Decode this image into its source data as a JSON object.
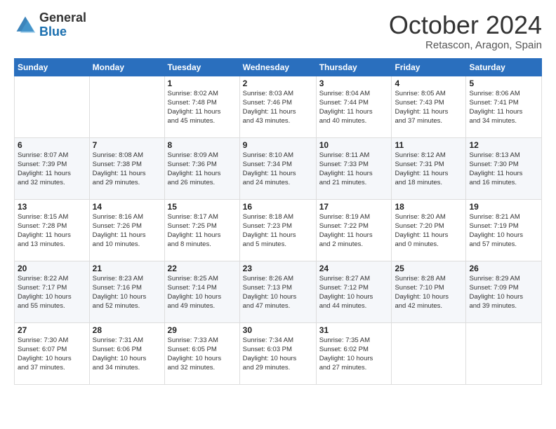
{
  "header": {
    "logo_general": "General",
    "logo_blue": "Blue",
    "month_title": "October 2024",
    "location": "Retascon, Aragon, Spain"
  },
  "days_of_week": [
    "Sunday",
    "Monday",
    "Tuesday",
    "Wednesday",
    "Thursday",
    "Friday",
    "Saturday"
  ],
  "weeks": [
    [
      {
        "day": "",
        "info": ""
      },
      {
        "day": "",
        "info": ""
      },
      {
        "day": "1",
        "info": "Sunrise: 8:02 AM\nSunset: 7:48 PM\nDaylight: 11 hours\nand 45 minutes."
      },
      {
        "day": "2",
        "info": "Sunrise: 8:03 AM\nSunset: 7:46 PM\nDaylight: 11 hours\nand 43 minutes."
      },
      {
        "day": "3",
        "info": "Sunrise: 8:04 AM\nSunset: 7:44 PM\nDaylight: 11 hours\nand 40 minutes."
      },
      {
        "day": "4",
        "info": "Sunrise: 8:05 AM\nSunset: 7:43 PM\nDaylight: 11 hours\nand 37 minutes."
      },
      {
        "day": "5",
        "info": "Sunrise: 8:06 AM\nSunset: 7:41 PM\nDaylight: 11 hours\nand 34 minutes."
      }
    ],
    [
      {
        "day": "6",
        "info": "Sunrise: 8:07 AM\nSunset: 7:39 PM\nDaylight: 11 hours\nand 32 minutes."
      },
      {
        "day": "7",
        "info": "Sunrise: 8:08 AM\nSunset: 7:38 PM\nDaylight: 11 hours\nand 29 minutes."
      },
      {
        "day": "8",
        "info": "Sunrise: 8:09 AM\nSunset: 7:36 PM\nDaylight: 11 hours\nand 26 minutes."
      },
      {
        "day": "9",
        "info": "Sunrise: 8:10 AM\nSunset: 7:34 PM\nDaylight: 11 hours\nand 24 minutes."
      },
      {
        "day": "10",
        "info": "Sunrise: 8:11 AM\nSunset: 7:33 PM\nDaylight: 11 hours\nand 21 minutes."
      },
      {
        "day": "11",
        "info": "Sunrise: 8:12 AM\nSunset: 7:31 PM\nDaylight: 11 hours\nand 18 minutes."
      },
      {
        "day": "12",
        "info": "Sunrise: 8:13 AM\nSunset: 7:30 PM\nDaylight: 11 hours\nand 16 minutes."
      }
    ],
    [
      {
        "day": "13",
        "info": "Sunrise: 8:15 AM\nSunset: 7:28 PM\nDaylight: 11 hours\nand 13 minutes."
      },
      {
        "day": "14",
        "info": "Sunrise: 8:16 AM\nSunset: 7:26 PM\nDaylight: 11 hours\nand 10 minutes."
      },
      {
        "day": "15",
        "info": "Sunrise: 8:17 AM\nSunset: 7:25 PM\nDaylight: 11 hours\nand 8 minutes."
      },
      {
        "day": "16",
        "info": "Sunrise: 8:18 AM\nSunset: 7:23 PM\nDaylight: 11 hours\nand 5 minutes."
      },
      {
        "day": "17",
        "info": "Sunrise: 8:19 AM\nSunset: 7:22 PM\nDaylight: 11 hours\nand 2 minutes."
      },
      {
        "day": "18",
        "info": "Sunrise: 8:20 AM\nSunset: 7:20 PM\nDaylight: 11 hours\nand 0 minutes."
      },
      {
        "day": "19",
        "info": "Sunrise: 8:21 AM\nSunset: 7:19 PM\nDaylight: 10 hours\nand 57 minutes."
      }
    ],
    [
      {
        "day": "20",
        "info": "Sunrise: 8:22 AM\nSunset: 7:17 PM\nDaylight: 10 hours\nand 55 minutes."
      },
      {
        "day": "21",
        "info": "Sunrise: 8:23 AM\nSunset: 7:16 PM\nDaylight: 10 hours\nand 52 minutes."
      },
      {
        "day": "22",
        "info": "Sunrise: 8:25 AM\nSunset: 7:14 PM\nDaylight: 10 hours\nand 49 minutes."
      },
      {
        "day": "23",
        "info": "Sunrise: 8:26 AM\nSunset: 7:13 PM\nDaylight: 10 hours\nand 47 minutes."
      },
      {
        "day": "24",
        "info": "Sunrise: 8:27 AM\nSunset: 7:12 PM\nDaylight: 10 hours\nand 44 minutes."
      },
      {
        "day": "25",
        "info": "Sunrise: 8:28 AM\nSunset: 7:10 PM\nDaylight: 10 hours\nand 42 minutes."
      },
      {
        "day": "26",
        "info": "Sunrise: 8:29 AM\nSunset: 7:09 PM\nDaylight: 10 hours\nand 39 minutes."
      }
    ],
    [
      {
        "day": "27",
        "info": "Sunrise: 7:30 AM\nSunset: 6:07 PM\nDaylight: 10 hours\nand 37 minutes."
      },
      {
        "day": "28",
        "info": "Sunrise: 7:31 AM\nSunset: 6:06 PM\nDaylight: 10 hours\nand 34 minutes."
      },
      {
        "day": "29",
        "info": "Sunrise: 7:33 AM\nSunset: 6:05 PM\nDaylight: 10 hours\nand 32 minutes."
      },
      {
        "day": "30",
        "info": "Sunrise: 7:34 AM\nSunset: 6:03 PM\nDaylight: 10 hours\nand 29 minutes."
      },
      {
        "day": "31",
        "info": "Sunrise: 7:35 AM\nSunset: 6:02 PM\nDaylight: 10 hours\nand 27 minutes."
      },
      {
        "day": "",
        "info": ""
      },
      {
        "day": "",
        "info": ""
      }
    ]
  ]
}
